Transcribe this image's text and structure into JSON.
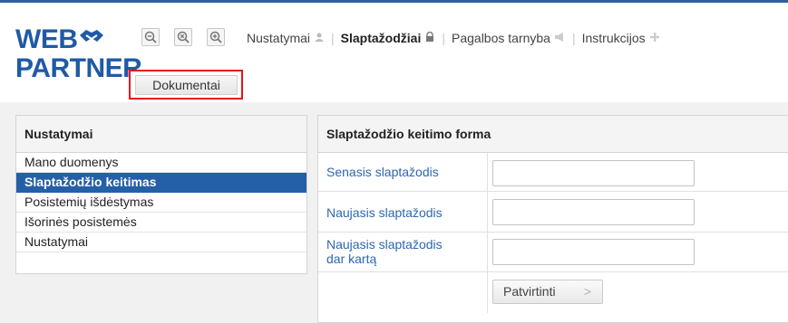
{
  "logo": {
    "line1": "WEB",
    "line2": "PARTNER"
  },
  "zoom": {
    "zoom_out": "zoom-out",
    "zoom_reset": "zoom-reset",
    "zoom_in": "zoom-in"
  },
  "top_nav": [
    {
      "label": "Nustatymai",
      "icon": "user-icon",
      "active": false
    },
    {
      "label": "Slaptažodžiai",
      "icon": "lock-icon",
      "active": true
    },
    {
      "label": "Pagalbos tarnyba",
      "icon": "megaphone-icon",
      "active": false
    },
    {
      "label": "Instrukcijos",
      "icon": "plus-icon",
      "active": false
    }
  ],
  "doc_button": {
    "label": "Dokumentai"
  },
  "left_panel": {
    "title": "Nustatymai",
    "items": [
      {
        "label": "Mano duomenys"
      },
      {
        "label": "Slaptažodžio keitimas"
      },
      {
        "label": "Posistemių išdėstymas"
      },
      {
        "label": "Išorinės posistemės"
      },
      {
        "label": "Nustatymai"
      }
    ]
  },
  "form": {
    "title": "Slaptažodžio keitimo forma",
    "fields": [
      {
        "label": "Senasis slaptažodis",
        "value": ""
      },
      {
        "label": "Naujasis slaptažodis",
        "value": ""
      },
      {
        "label_line1": "Naujasis slaptažodis",
        "label_line2": "dar kartą",
        "value": ""
      }
    ],
    "submit": "Patvirtinti",
    "submit_arrow": ">"
  },
  "colors": {
    "brand": "#1f5aa6",
    "active": "#2460a7",
    "highlight": "#e8141a",
    "link": "#2d67b0"
  }
}
